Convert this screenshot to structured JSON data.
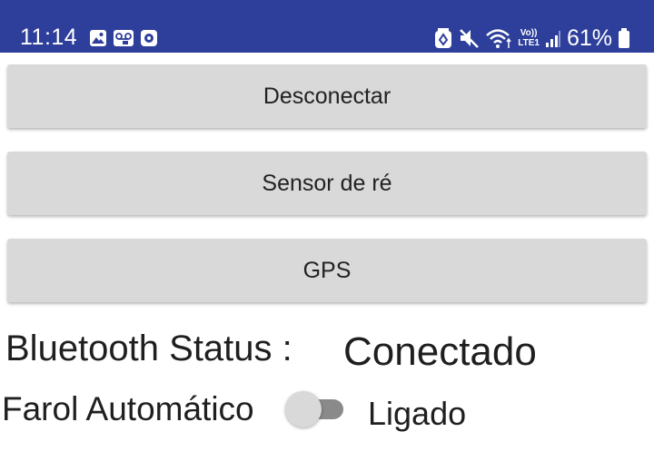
{
  "status_bar": {
    "time": "11:14",
    "battery_percent": "61%",
    "background_color": "#2e3f9b",
    "left_icons": [
      "image-notification-icon",
      "voicemail-icon",
      "media-notification-icon"
    ],
    "right_icons": [
      "data-saver-icon",
      "mute-icon",
      "wifi-icon",
      "volte-icon",
      "signal-icon",
      "battery-icon"
    ],
    "volte_label": "Vo))",
    "lte_label": "LTE1"
  },
  "buttons": {
    "disconnect": "Desconectar",
    "rear_sensor": "Sensor de ré",
    "gps": "GPS"
  },
  "bluetooth": {
    "label": "Bluetooth Status :",
    "value": "Conectado"
  },
  "farol": {
    "label": "Farol Automático",
    "switch_on": false,
    "state": "Ligado"
  }
}
